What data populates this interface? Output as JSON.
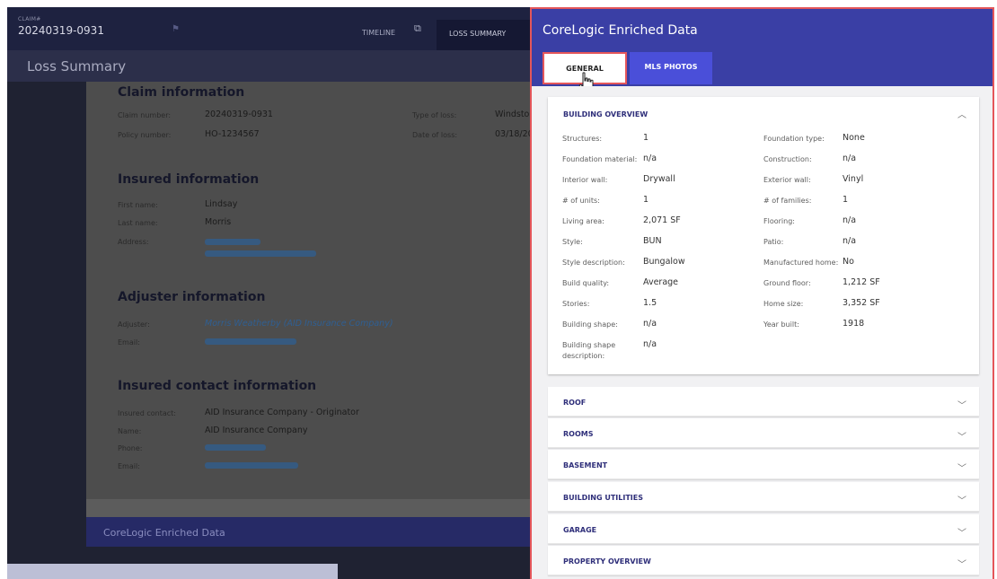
{
  "app": {
    "claim_label": "CLAIM#",
    "claim_number": "20240319-0931",
    "tabs": {
      "timeline": "TIMELINE",
      "loss_summary": "LOSS SUMMARY"
    },
    "page_title": "Loss Summary"
  },
  "claim_info": {
    "heading": "Claim information",
    "claim_number_label": "Claim number:",
    "claim_number": "20240319-0931",
    "policy_number_label": "Policy number:",
    "policy_number": "HO-1234567",
    "type_of_loss_label": "Type of loss:",
    "type_of_loss": "Windstor",
    "date_of_loss_label": "Date of loss:",
    "date_of_loss": "03/18/20"
  },
  "insured_info": {
    "heading": "Insured information",
    "first_name_label": "First name:",
    "first_name": "Lindsay",
    "last_name_label": "Last name:",
    "last_name": "Morris",
    "address_label": "Address:"
  },
  "adjuster_info": {
    "heading": "Adjuster information",
    "adjuster_label": "Adjuster:",
    "adjuster": "Morris Weatherby (AID Insurance Company)",
    "email_label": "Email:"
  },
  "contact_info": {
    "heading": "Insured contact information",
    "contact_label": "Insured contact:",
    "contact": "AID Insurance Company - Originator",
    "name_label": "Name:",
    "name": "AID Insurance Company",
    "phone_label": "Phone:",
    "email_label": "Email:"
  },
  "bottom_section": {
    "title": "CoreLogic Enriched Data"
  },
  "panel": {
    "title": "CoreLogic Enriched Data",
    "tabs": {
      "general": "GENERAL",
      "mls_photos": "MLS PHOTOS"
    },
    "building_overview": {
      "title": "BUILDING OVERVIEW",
      "left": [
        {
          "label": "Structures:",
          "value": "1"
        },
        {
          "label": "Foundation material:",
          "value": "n/a"
        },
        {
          "label": "Interior wall:",
          "value": "Drywall"
        },
        {
          "label": "# of units:",
          "value": "1"
        },
        {
          "label": "Living area:",
          "value": "2,071 SF"
        },
        {
          "label": "Style:",
          "value": "BUN"
        },
        {
          "label": "Style description:",
          "value": "Bungalow"
        },
        {
          "label": "Build quality:",
          "value": "Average"
        },
        {
          "label": "Stories:",
          "value": "1.5"
        },
        {
          "label": "Building shape:",
          "value": "n/a"
        },
        {
          "label": "Building shape description:",
          "value": "n/a"
        }
      ],
      "right": [
        {
          "label": "Foundation type:",
          "value": "None"
        },
        {
          "label": "Construction:",
          "value": "n/a"
        },
        {
          "label": "Exterior wall:",
          "value": "Vinyl"
        },
        {
          "label": "# of families:",
          "value": "1"
        },
        {
          "label": "Flooring:",
          "value": "n/a"
        },
        {
          "label": "Patio:",
          "value": "n/a"
        },
        {
          "label": "Manufactured home:",
          "value": "No"
        },
        {
          "label": "Ground floor:",
          "value": "1,212 SF"
        },
        {
          "label": "Home size:",
          "value": "3,352 SF"
        },
        {
          "label": "Year built:",
          "value": "1918"
        }
      ]
    },
    "sections": [
      "ROOF",
      "ROOMS",
      "BASEMENT",
      "BUILDING UTILITIES",
      "GARAGE",
      "PROPERTY OVERVIEW"
    ]
  }
}
